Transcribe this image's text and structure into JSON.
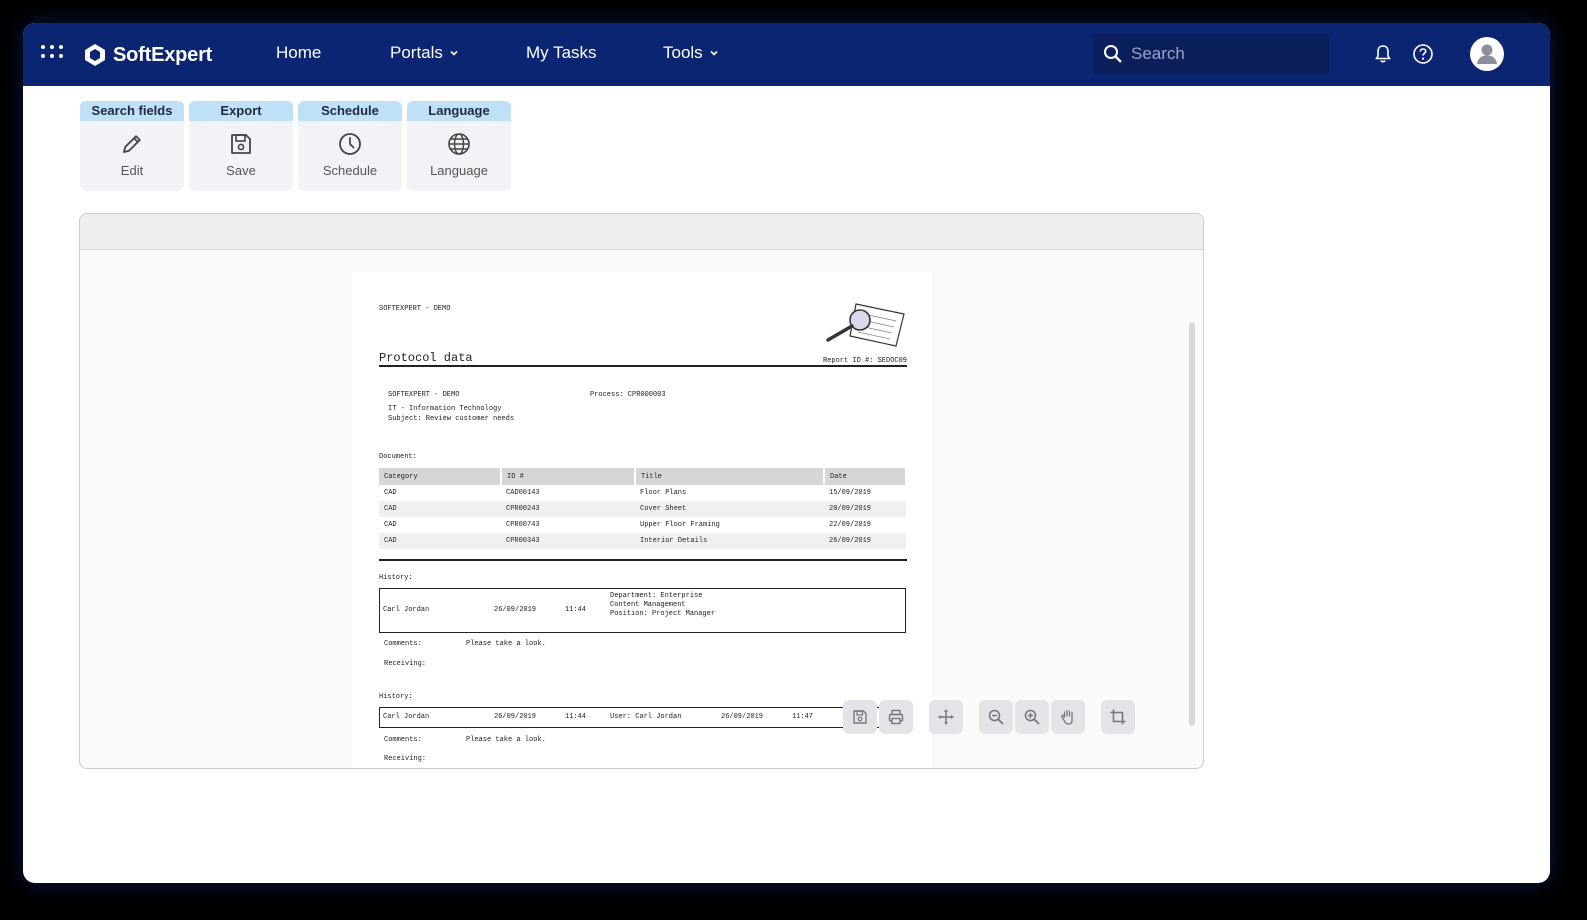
{
  "brand": {
    "name": "SoftExpert"
  },
  "nav": {
    "home": "Home",
    "portals": "Portals",
    "my_tasks": "My Tasks",
    "tools": "Tools"
  },
  "search": {
    "placeholder": "Search"
  },
  "toolbar": [
    {
      "title": "Search fields",
      "label": "Edit",
      "icon": "pencil-icon"
    },
    {
      "title": "Export",
      "label": "Save",
      "icon": "save-icon"
    },
    {
      "title": "Schedule",
      "label": "Schedule",
      "icon": "clock-icon"
    },
    {
      "title": "Language",
      "label": "Language",
      "icon": "globe-icon"
    }
  ],
  "report": {
    "company": "SOFTEXPERT - DEMO",
    "title": "Protocol data",
    "report_id": "Report ID #: SEDOC09",
    "org_company": "SOFTEXPERT - DEMO",
    "org_unit": "IT  - Information Technology",
    "subject": "Subject: Review customer needs",
    "process": "Process: CPR000003",
    "documents_label": "Document:",
    "doc_columns": [
      "Category",
      "ID #",
      "Title",
      "Date"
    ],
    "doc_rows": [
      [
        "CAD",
        "CAD00143",
        "Floor Plans",
        "15/09/2019"
      ],
      [
        "CAD",
        "CPR00243",
        "Cover Sheet",
        "20/09/2019"
      ],
      [
        "CAD",
        "CPR00743",
        "Upper Floor Framing",
        "22/09/2019"
      ],
      [
        "CAD",
        "CPR00343",
        "Interior Details",
        "26/09/2019"
      ]
    ],
    "history1": {
      "label": "History:",
      "user": "Carl Jordan",
      "date": "26/09/2019",
      "time": "11:44",
      "department": "Department: Enterprise",
      "area": "Content Management",
      "position": "Position: Project Manager",
      "comments_label": "Comments:",
      "comments": "Please take a look.",
      "receiving_label": "Receiving:"
    },
    "history2": {
      "label": "History:",
      "user": "Carl Jordan",
      "date": "26/09/2019",
      "time": "11:44",
      "target_user": "User: Carl Jordan",
      "target_date": "26/09/2019",
      "target_time": "11:47",
      "comments_label": "Comments:",
      "comments": "Please take a look.",
      "receiving_label": "Receiving:"
    }
  },
  "viewer_tools": [
    "save-icon",
    "print-icon",
    "move-icon",
    "zoom-out-icon",
    "zoom-in-icon",
    "hand-icon",
    "crop-icon"
  ]
}
